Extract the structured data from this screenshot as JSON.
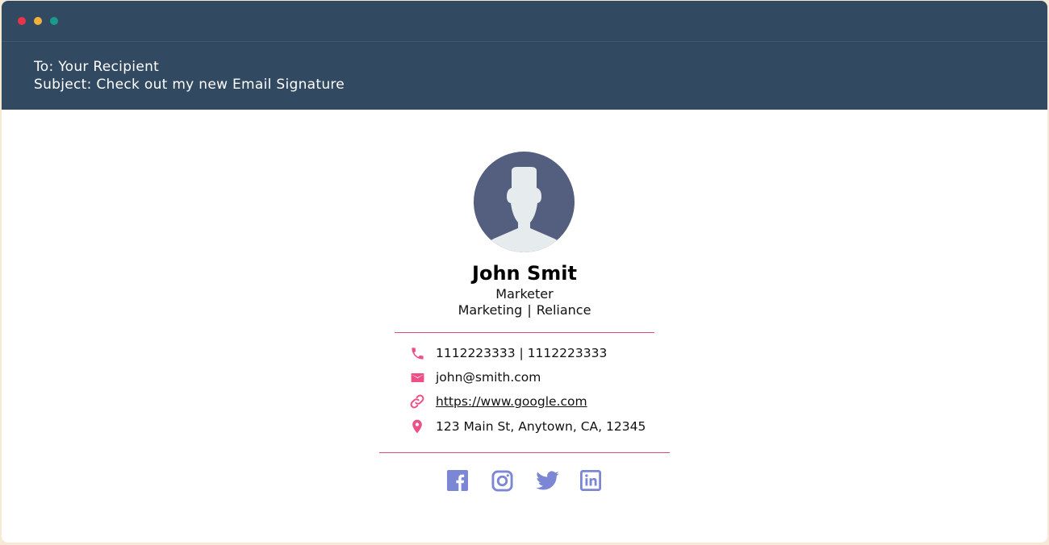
{
  "window": {
    "dots": [
      "#e8344a",
      "#f2b23a",
      "#1a9a8a"
    ]
  },
  "email": {
    "to_line": "To: Your Recipient",
    "subject_line": "Subject: Check out my new Email Signature"
  },
  "signature": {
    "name": "John Smit",
    "title": "Marketer",
    "department": "Marketing",
    "separator": "|",
    "company": "Reliance",
    "contacts": {
      "phone": {
        "icon": "phone-icon",
        "text": "1112223333 | 1112223333"
      },
      "email": {
        "icon": "mail-icon",
        "text": "john@smith.com"
      },
      "website": {
        "icon": "link-icon",
        "text": "https://www.google.com"
      },
      "address": {
        "icon": "location-pin-icon",
        "text": "123 Main St, Anytown, CA, 12345"
      }
    },
    "social": [
      "facebook-icon",
      "instagram-icon",
      "twitter-icon",
      "linkedin-icon"
    ]
  },
  "colors": {
    "header_bg": "#314961",
    "accent": "#d84b86",
    "icon_pink": "#ee4f86",
    "social": "#7b86d4",
    "avatar_bg": "#545f7f",
    "avatar_figure": "#e6ebee"
  }
}
